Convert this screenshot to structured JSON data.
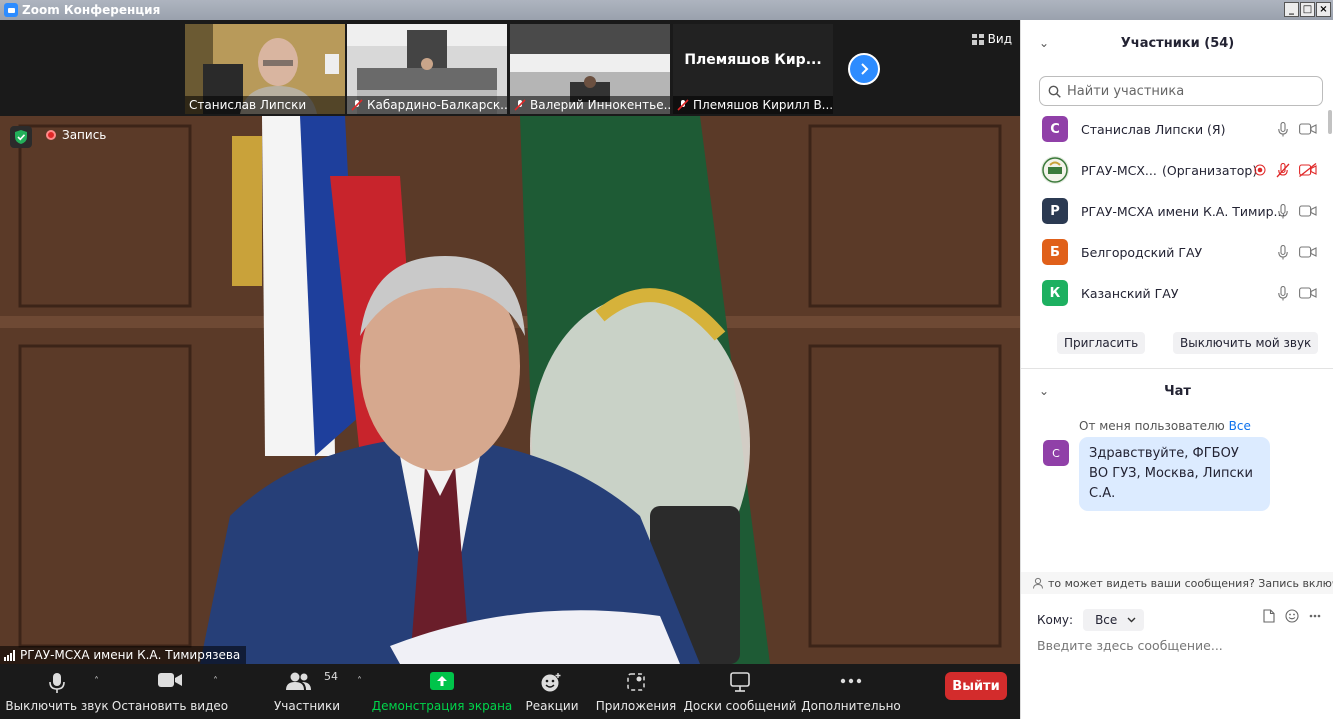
{
  "window": {
    "title": "Zoom Конференция"
  },
  "thumbnails": [
    {
      "name": "Станислав Липски",
      "muted": false
    },
    {
      "name": "Кабардино-Балкарск...",
      "muted": true
    },
    {
      "name": "Валерий Иннокентье...",
      "muted": true
    },
    {
      "name": "Племяшов Кирилл В...",
      "muted": true,
      "big_name": "Племяшов Кир..."
    }
  ],
  "view_label": "Вид",
  "recording_label": "Запись",
  "speaker_label": "РГАУ-МСХА имени К.А. Тимирязева",
  "toolbar": {
    "mute": "Выключить звук",
    "video": "Остановить видео",
    "participants": "Участники",
    "participants_count": "54",
    "share": "Демонстрация экрана",
    "reactions": "Реакции",
    "apps": "Приложения",
    "whiteboards": "Доски сообщений",
    "more": "Дополнительно",
    "leave": "Выйти",
    "share_color": "#00d44a",
    "leave_color": "#d32c2c"
  },
  "participants_panel": {
    "title": "Участники (54)",
    "search_placeholder": "Найти участника",
    "list": [
      {
        "initial": "С",
        "name": "Станислав Липски (Я)",
        "color": "#9040a8",
        "mic": "on",
        "video": "on"
      },
      {
        "initial": "",
        "name": "РГАУ-МСХ...",
        "role": "(Организатор)",
        "color": "#3b7a3b",
        "mic": "off",
        "video": "off",
        "recording": true
      },
      {
        "initial": "Р",
        "name": "РГАУ-МСХА имени К.А. Тимир...",
        "color": "#2b3a52",
        "mic": "on",
        "video": "on"
      },
      {
        "initial": "Б",
        "name": "Белгородский ГАУ",
        "color": "#e0601a",
        "mic": "on",
        "video": "on"
      },
      {
        "initial": "К",
        "name": "Казанский ГАУ",
        "color": "#1db060",
        "mic": "on",
        "video": "on"
      }
    ],
    "invite": "Пригласить",
    "mute_me": "Выключить мой звук"
  },
  "chat": {
    "title": "Чат",
    "from": "От меня пользователю",
    "to_everyone": "Все",
    "avatar_initial": "С",
    "message": "Здравствуйте, ФГБОУ ВО ГУЗ, Москва, Липски С.А.",
    "visibility_notice": "то может видеть ваши сообщения? Запись включе",
    "to_label": "Кому:",
    "to_value": "Все",
    "input_placeholder": "Введите здесь сообщение..."
  }
}
